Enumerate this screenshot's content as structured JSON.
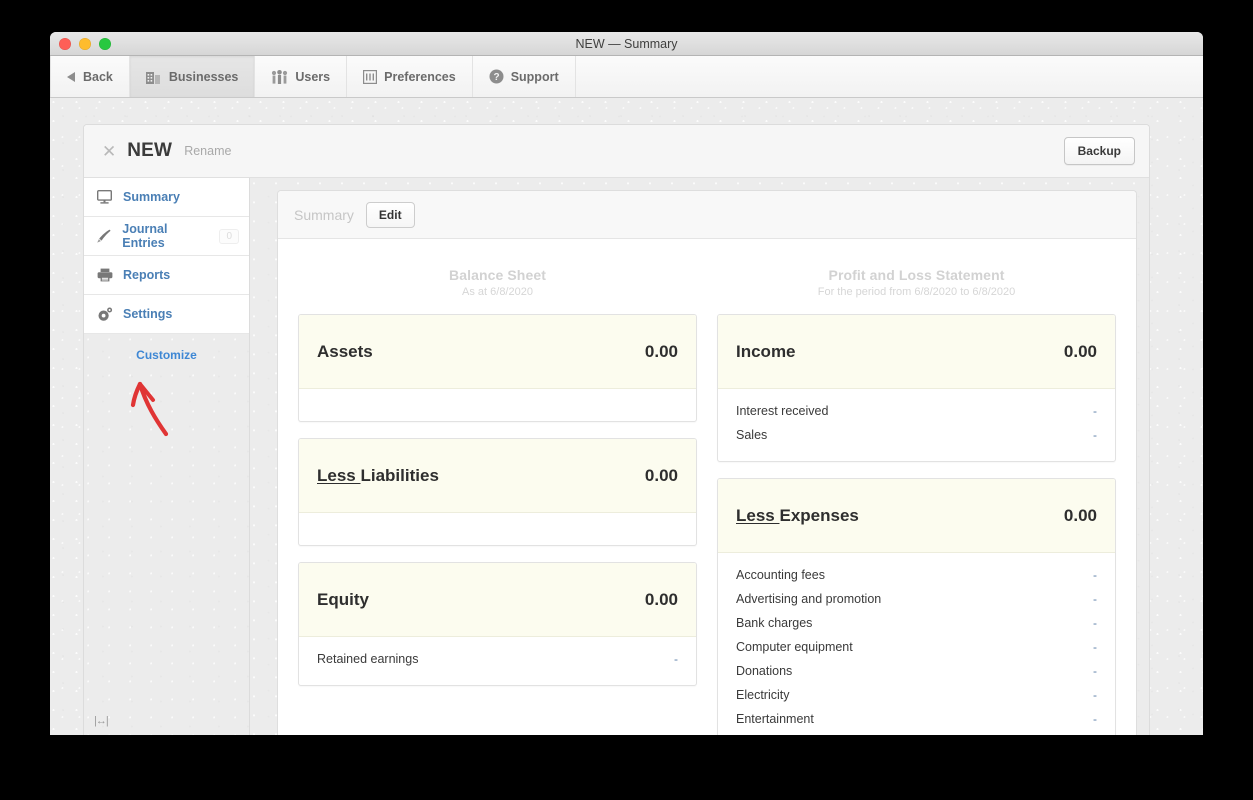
{
  "window": {
    "title": "NEW — Summary",
    "traffic_lights": [
      "close-button",
      "minimize-button",
      "maximize-button"
    ]
  },
  "toolbar": {
    "items": [
      {
        "label": "Back",
        "icon": "back-triangle-icon",
        "active": false
      },
      {
        "label": "Businesses",
        "icon": "buildings-icon",
        "active": true
      },
      {
        "label": "Users",
        "icon": "people-icon",
        "active": false
      },
      {
        "label": "Preferences",
        "icon": "sliders-icon",
        "active": false
      },
      {
        "label": "Support",
        "icon": "question-circle-icon",
        "active": false
      }
    ]
  },
  "business_header": {
    "close_glyph": "✕",
    "name": "NEW",
    "rename_label": "Rename",
    "backup_label": "Backup"
  },
  "sidebar": {
    "items": [
      {
        "label": "Summary",
        "icon": "monitor-icon",
        "badge": null
      },
      {
        "label": "Journal Entries",
        "icon": "pen-icon",
        "badge": "0"
      },
      {
        "label": "Reports",
        "icon": "printer-icon",
        "badge": null
      },
      {
        "label": "Settings",
        "icon": "gear-icon",
        "badge": null
      }
    ],
    "customize_label": "Customize",
    "resize_glyph": "|↔|",
    "annotation": "red-hand-drawn-arrow pointing to Customize"
  },
  "report": {
    "breadcrumb": "Summary",
    "edit_label": "Edit",
    "columns": [
      {
        "title": "Balance Sheet",
        "subtitle": "As at 6/8/2020",
        "sections": [
          {
            "prefix": "",
            "title": "Assets",
            "total": "0.00",
            "rows": []
          },
          {
            "prefix": "Less ",
            "title": "Liabilities",
            "total": "0.00",
            "rows": []
          },
          {
            "prefix": "",
            "title": "Equity",
            "total": "0.00",
            "rows": [
              {
                "label": "Retained earnings",
                "amount": "-"
              }
            ]
          }
        ]
      },
      {
        "title": "Profit and Loss Statement",
        "subtitle": "For the period from 6/8/2020 to 6/8/2020",
        "sections": [
          {
            "prefix": "",
            "title": "Income",
            "total": "0.00",
            "rows": [
              {
                "label": "Interest received",
                "amount": "-"
              },
              {
                "label": "Sales",
                "amount": "-"
              }
            ]
          },
          {
            "prefix": "Less ",
            "title": "Expenses",
            "total": "0.00",
            "rows": [
              {
                "label": "Accounting fees",
                "amount": "-"
              },
              {
                "label": "Advertising and promotion",
                "amount": "-"
              },
              {
                "label": "Bank charges",
                "amount": "-"
              },
              {
                "label": "Computer equipment",
                "amount": "-"
              },
              {
                "label": "Donations",
                "amount": "-"
              },
              {
                "label": "Electricity",
                "amount": "-"
              },
              {
                "label": "Entertainment",
                "amount": "-"
              }
            ]
          }
        ]
      }
    ]
  },
  "colors": {
    "accent_link": "#3e87d4",
    "nav_label": "#4a7fb5",
    "card_header_cream": "#fcfcef",
    "annotation_red": "#e03535",
    "amount_blue": "#5d7fa8"
  }
}
